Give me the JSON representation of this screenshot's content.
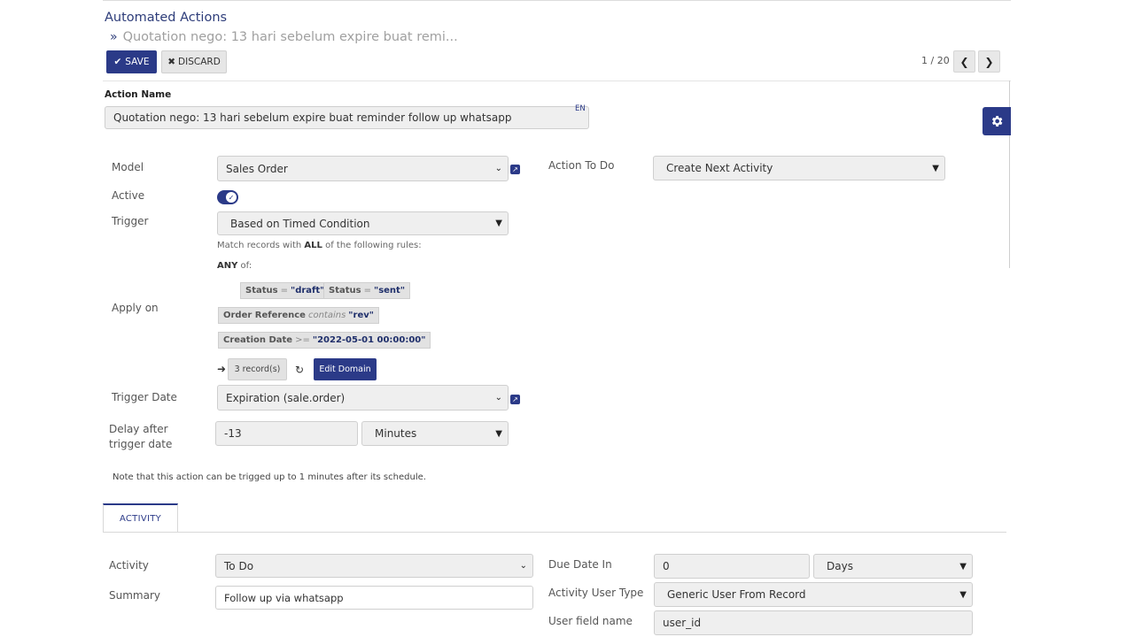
{
  "breadcrumb": {
    "title": "Automated Actions",
    "current": "Quotation nego: 13 hari sebelum expire buat remi..."
  },
  "toolbar": {
    "save_label": "SAVE",
    "discard_label": "DISCARD"
  },
  "pager": {
    "text": "1 / 20"
  },
  "action_name": {
    "label": "Action Name",
    "value": "Quotation nego: 13 hari sebelum expire buat reminder follow up whatsapp",
    "lang": "EN"
  },
  "model": {
    "label": "Model",
    "value": "Sales Order"
  },
  "action_to_do": {
    "label": "Action To Do",
    "value": "Create Next Activity"
  },
  "active": {
    "label": "Active",
    "checked": true
  },
  "trigger": {
    "label": "Trigger",
    "value": "Based on Timed Condition"
  },
  "apply_on": {
    "label": "Apply on",
    "match_prefix": "Match records with ",
    "match_bold": "ALL",
    "match_suffix": " of the following rules:",
    "any_bold": "ANY",
    "any_suffix": " of:",
    "rules": [
      {
        "field": "Status",
        "op": "=",
        "value": "\"draft\""
      },
      {
        "field": "Status",
        "op": "=",
        "value": "\"sent\""
      },
      {
        "field": "Order Reference",
        "op": "contains",
        "value": "\"rev\""
      },
      {
        "field": "Creation Date",
        "op": ">=",
        "value": "\"2022-05-01 00:00:00\""
      }
    ],
    "records_label": "3 record(s)",
    "edit_domain_label": "Edit Domain"
  },
  "trigger_date": {
    "label": "Trigger Date",
    "value": "Expiration (sale.order)"
  },
  "delay": {
    "label_line1": "Delay after",
    "label_line2": "trigger date",
    "value": "-13",
    "unit": "Minutes"
  },
  "note": "Note that this action can be trigged up to 1 minutes after its schedule.",
  "tabs": [
    {
      "label": "ACTIVITY"
    }
  ],
  "activity": {
    "activity_label": "Activity",
    "activity_value": "To Do",
    "summary_label": "Summary",
    "summary_value": "Follow up via whatsapp",
    "due_label": "Due Date In",
    "due_value": "0",
    "due_unit": "Days",
    "user_type_label": "Activity User Type",
    "user_type_value": "Generic User From Record",
    "user_field_label": "User field name",
    "user_field_value": "user_id"
  },
  "colors": {
    "accent": "#2b3a88"
  },
  "icons": [
    "check-icon",
    "close-icon",
    "chevron-left-icon",
    "chevron-right-icon",
    "gear-icon",
    "external-link-icon",
    "arrow-right-icon",
    "refresh-icon",
    "chevron-down-icon"
  ]
}
